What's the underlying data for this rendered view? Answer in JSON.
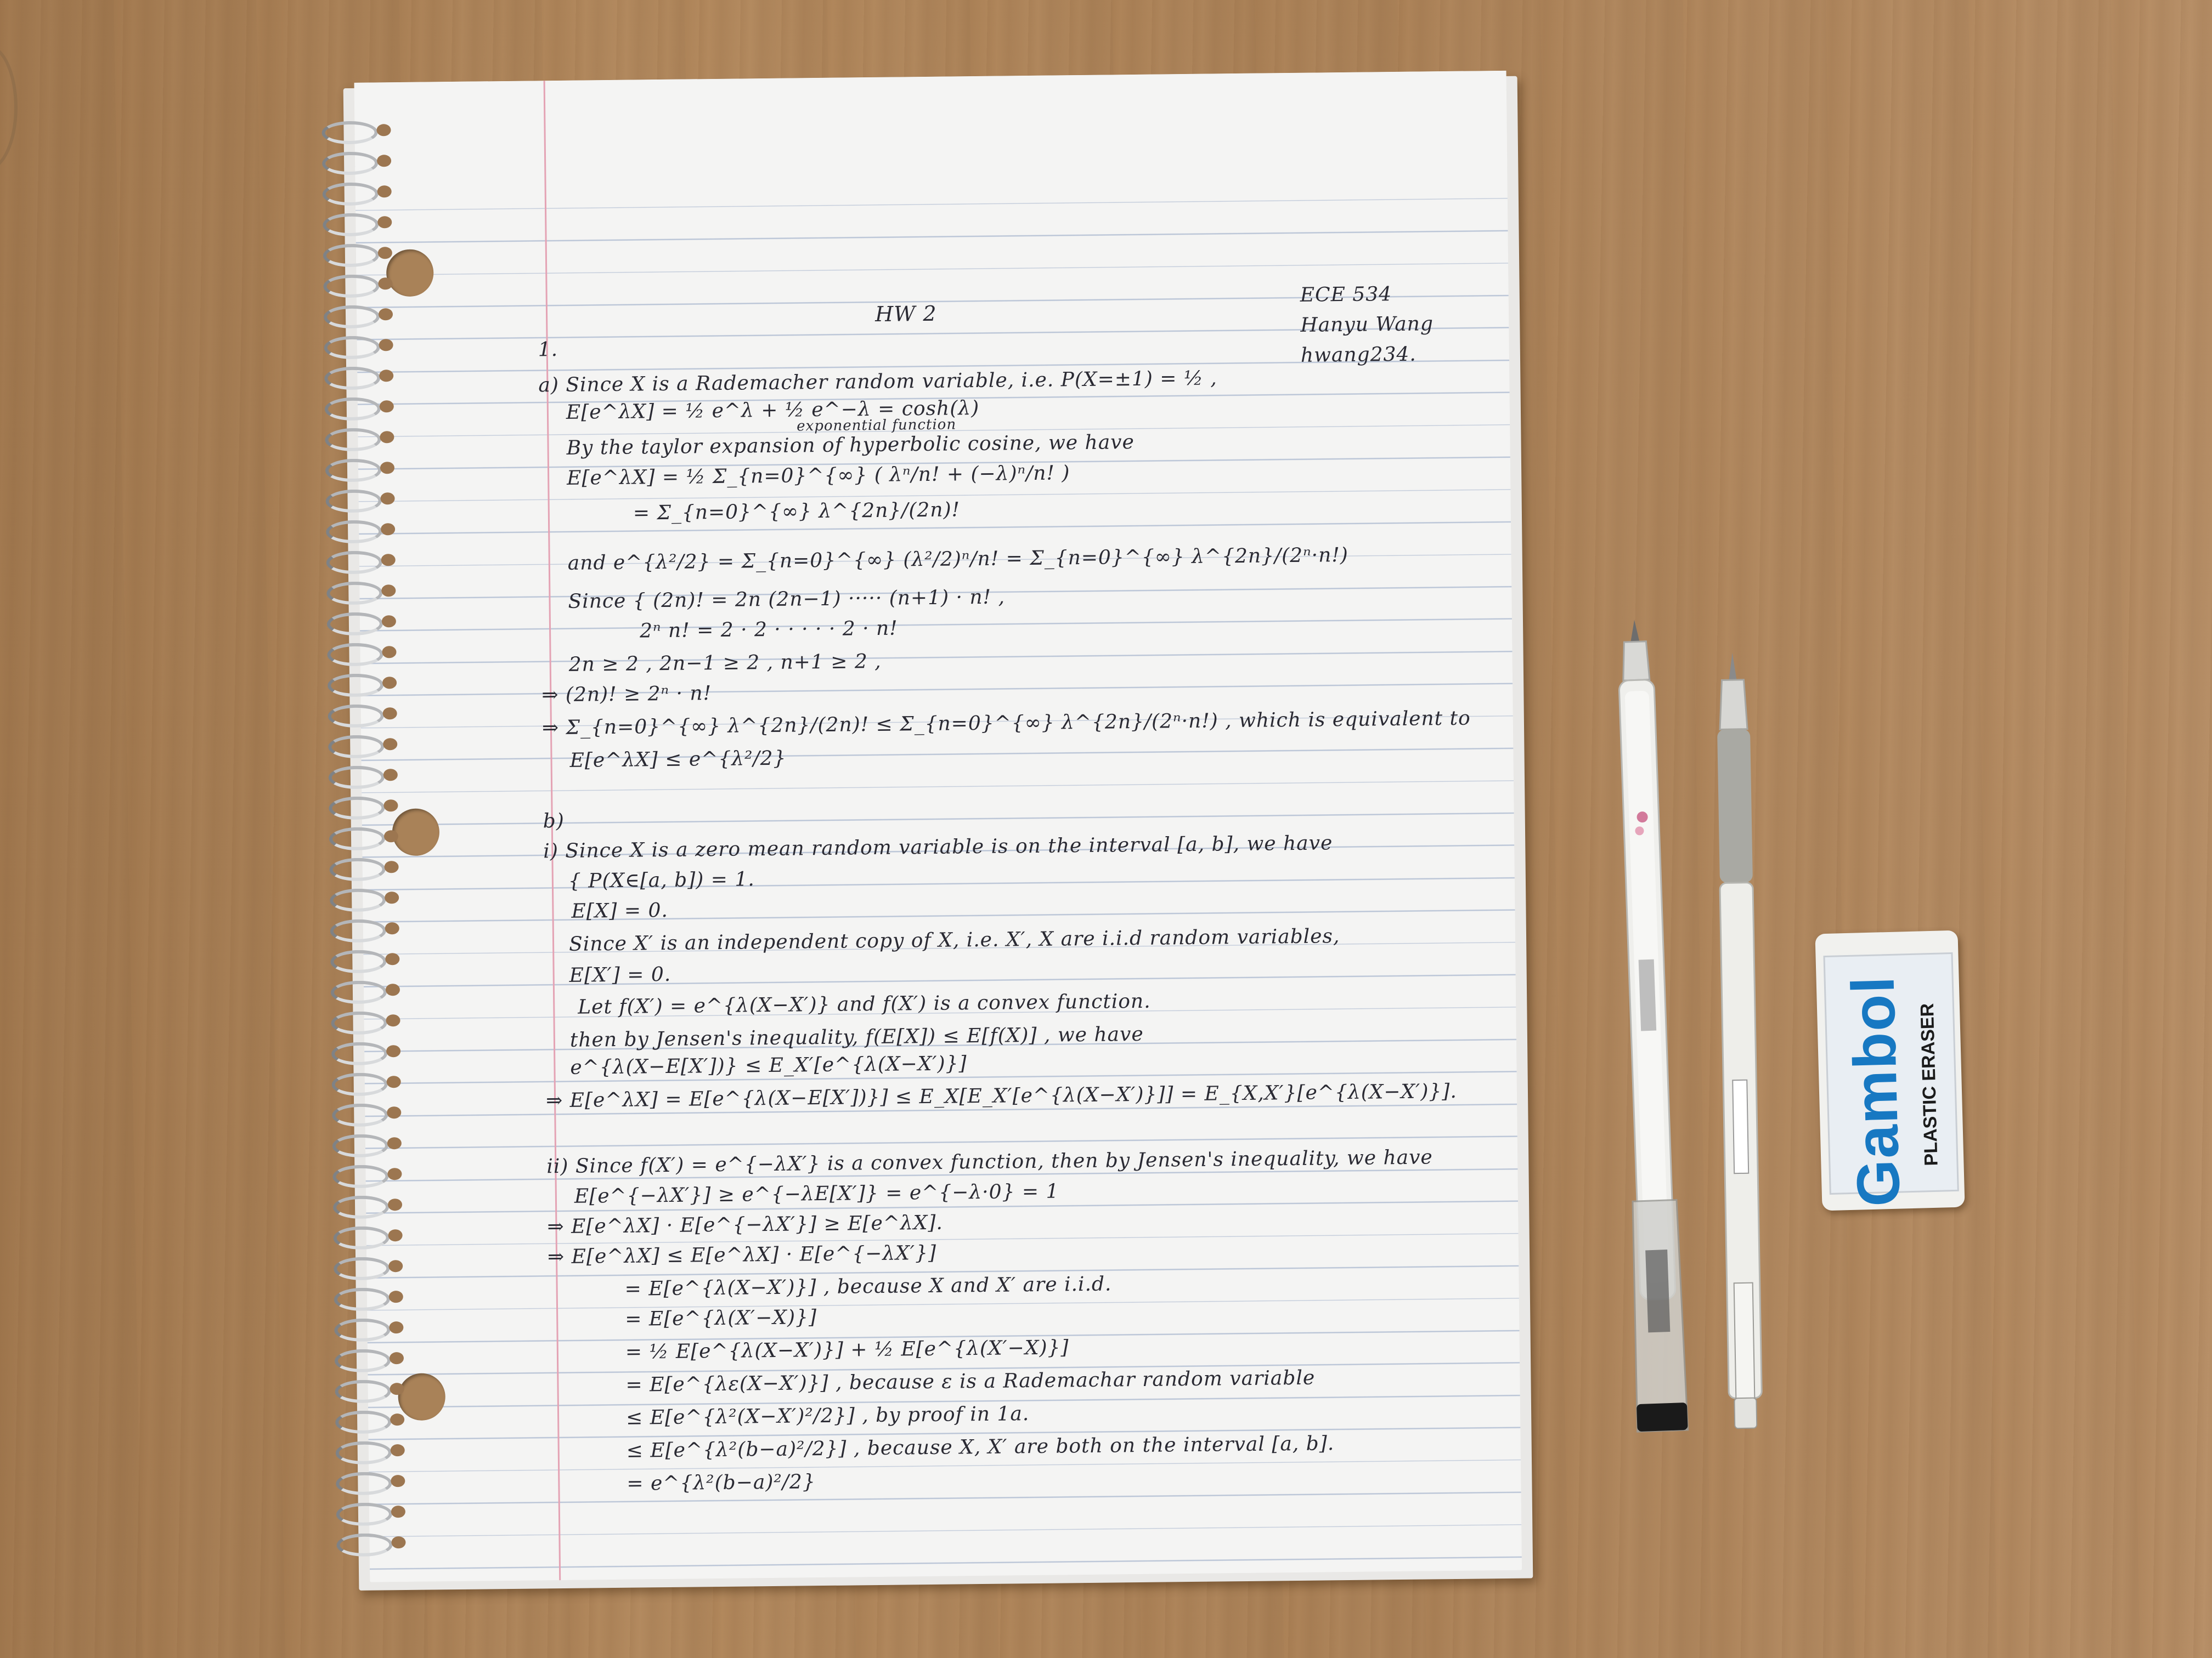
{
  "header": {
    "title": "HW  2",
    "course": "ECE 534",
    "name": "Hanyu Wang",
    "netid": "hwang234."
  },
  "problem1": {
    "number": "1.",
    "a_lines": [
      "a) Since  X is a Rademacher random variable, i.e. P(X=±1) = ½ ,",
      "E[e^λX] = ½ e^λ + ½ e^−λ = cosh(λ)",
      "exponential function",
      "By the taylor expansion of hyperbolic cosine, we have",
      "E[e^λX] = ½ Σ_{n=0}^{∞} ( λⁿ/n! + (−λ)ⁿ/n! )",
      "= Σ_{n=0}^{∞} λ^{2n}/(2n)!",
      "and e^{λ²/2} = Σ_{n=0}^{∞} (λ²/2)ⁿ/n! = Σ_{n=0}^{∞} λ^{2n}/(2ⁿ·n!)",
      "Since { (2n)! = 2n (2n−1) ····· (n+1) · n! ,",
      "2ⁿ n! = 2 · 2 ·  ·  ·  ·  · 2 · n!",
      "2n ≥ 2 ,  2n−1 ≥ 2 ,  n+1 ≥ 2 ,",
      "⇒ (2n)! ≥ 2ⁿ · n!",
      "⇒ Σ_{n=0}^{∞} λ^{2n}/(2n)! ≤ Σ_{n=0}^{∞} λ^{2n}/(2ⁿ·n!) ,  which is equivalent to",
      "E[e^λX] ≤ e^{λ²/2}"
    ],
    "b_label": "b)",
    "bi_lines": [
      "i) Since X is a zero mean random variable is on the interval [a, b], we have",
      "{ P(X∈[a, b]) = 1.",
      "E[X] = 0.",
      "Since X′ is an independent copy of X, i.e. X′, X are i.i.d random variables,",
      "E[X′] = 0.",
      "Let f(X′) = e^{λ(X−X′)} and f(X′) is a convex function.",
      "then by Jensen's inequality,  f(E[X]) ≤ E[f(X)] , we have",
      "e^{λ(X−E[X′])} ≤ E_X′[e^{λ(X−X′)}]",
      "⇒ E[e^λX] = E[e^{λ(X−E[X′])}] ≤ E_X[E_X′[e^{λ(X−X′)}]] = E_{X,X′}[e^{λ(X−X′)}]."
    ],
    "bii_lines": [
      "ii) Since f(X′) = e^{−λX′} is a convex function, then by Jensen's inequality, we have",
      "E[e^{−λX′}] ≥ e^{−λE[X′]} = e^{−λ·0} = 1",
      "⇒ E[e^λX] · E[e^{−λX′}] ≥ E[e^λX].",
      "⇒ E[e^λX] ≤ E[e^λX] · E[e^{−λX′}]",
      "= E[e^{λ(X−X′)}] ,  because X and X′ are i.i.d.",
      "= E[e^{λ(X′−X)}]",
      "= ½ E[e^{λ(X−X′)}] + ½ E[e^{λ(X′−X)}]",
      "= E[e^{λε(X−X′)}] ,  because ε is a Rademachar random variable",
      "≤ E[e^{λ²(X−X′)²/2}] ,  by proof in 1a.",
      "≤ E[e^{λ²(b−a)²/2}] ,  because X, X′ are both on the interval [a, b].",
      "= e^{λ²(b−a)²/2}"
    ]
  },
  "eraser": {
    "brand": "Gambol",
    "type": "PLASTIC ERASER"
  }
}
